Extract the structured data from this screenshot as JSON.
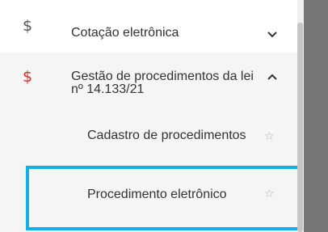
{
  "menu": {
    "items": [
      {
        "icon": "dollar-icon",
        "symbol": "$",
        "label": "Cotação eletrônica",
        "expanded": false,
        "icon_color": "#555555"
      },
      {
        "icon": "dollar-icon",
        "symbol": "$",
        "label": "Gestão de procedimentos da lei nº 14.133/21",
        "expanded": true,
        "icon_color": "#d32f2f",
        "subitems": [
          {
            "label": "Cadastro de procedimentos",
            "star": "☆"
          },
          {
            "label": "Procedimento eletrônico",
            "star": "☆",
            "highlighted": true
          }
        ]
      }
    ]
  },
  "colors": {
    "highlight_border": "#16aee6",
    "group_background": "#f5f5f5",
    "right_panel": "#767676"
  }
}
